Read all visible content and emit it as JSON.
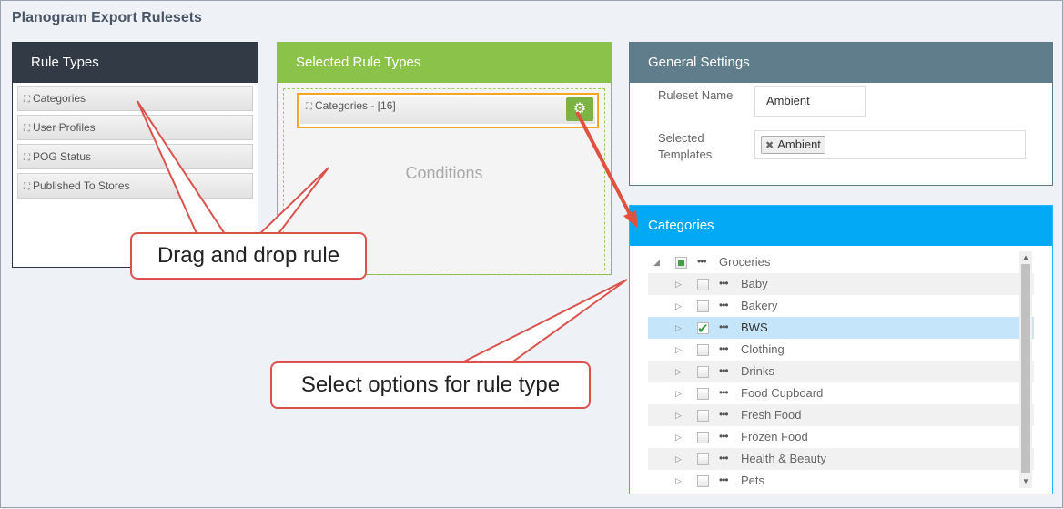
{
  "page": {
    "title": "Planogram Export Rulesets"
  },
  "rule_types": {
    "title": "Rule Types",
    "items": [
      "Categories",
      "User Profiles",
      "POG Status",
      "Published To Stores"
    ]
  },
  "selected_rule_types": {
    "title": "Selected Rule Types",
    "selected_rule_label": "Categories - [16]",
    "conditions_placeholder": "Conditions"
  },
  "general_settings": {
    "title": "General Settings",
    "ruleset_name_label": "Ruleset Name",
    "ruleset_name_value": "Ambient",
    "selected_templates_label": "Selected Templates",
    "selected_templates": [
      "Ambient"
    ]
  },
  "categories": {
    "title": "Categories",
    "tree": [
      {
        "label": "Groceries",
        "level": 0,
        "state": "partial",
        "expanded": true
      },
      {
        "label": "Baby",
        "level": 1,
        "state": "unchecked"
      },
      {
        "label": "Bakery",
        "level": 1,
        "state": "unchecked"
      },
      {
        "label": "BWS",
        "level": 1,
        "state": "checked",
        "selected": true
      },
      {
        "label": "Clothing",
        "level": 1,
        "state": "unchecked"
      },
      {
        "label": "Drinks",
        "level": 1,
        "state": "unchecked"
      },
      {
        "label": "Food Cupboard",
        "level": 1,
        "state": "unchecked"
      },
      {
        "label": "Fresh Food",
        "level": 1,
        "state": "unchecked"
      },
      {
        "label": "Frozen Food",
        "level": 1,
        "state": "unchecked"
      },
      {
        "label": "Health & Beauty",
        "level": 1,
        "state": "unchecked"
      },
      {
        "label": "Pets",
        "level": 1,
        "state": "unchecked"
      }
    ]
  },
  "callouts": {
    "drag": "Drag and drop rule",
    "select": "Select options for rule type"
  },
  "colors": {
    "accent_green": "#8bc34a",
    "accent_blue": "#03a9f4",
    "callout_red": "#d9534f",
    "highlight_orange": "#f5a623"
  }
}
